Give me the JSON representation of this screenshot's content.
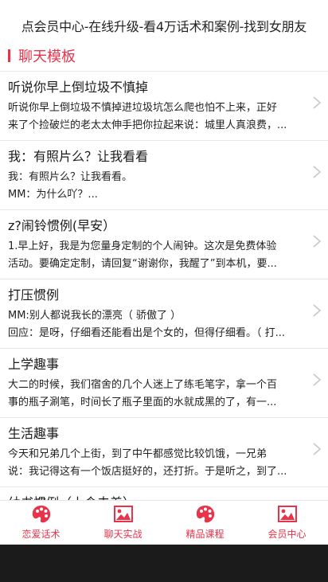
{
  "banner": {
    "text": "点会员中心-在线升级-看4万话术和案例-找到女朋友"
  },
  "section": {
    "title": "聊天模板"
  },
  "items": [
    {
      "title": "听说你早上倒垃圾不慎掉",
      "line1": "听说你早上倒垃圾不慎掉进垃圾坑怎么爬也怕不上来，正好",
      "line2": "来了个捡破烂的老太太伸手把你拉起来说：城里人真浪费，..."
    },
    {
      "title": "我：有照片么？让我看看",
      "line1": "我：有照片么？让我看看。",
      "line2": "MM：为什么吖？..."
    },
    {
      "title": "z?闹铃惯例(早安）",
      "line1": "1.早上好，我是为您量身定制的个人闹钟。这次是免费体验",
      "line2": "活动。要确定定制，请回复“谢谢你，我醒了”到本机，要..."
    },
    {
      "title": "打压惯例",
      "line1": "MM:别人都说我长的漂亮（  骄傲了  ）",
      "line2": "回应：是呀，仔细看还能看出是个女的，但得仔细看。（  打..."
    },
    {
      "title": "上学趣事",
      "line1": "大二的时候，我们宿舍的几个人迷上了练毛笔字，拿一个百",
      "line2": "事的瓶子涮笔，时间长了瓶子里面的水就成黑的了，有一..."
    },
    {
      "title": "生活趣事",
      "line1": "今天和兄弟几个上街，到了中午都感觉比较饥饿，一兄弟",
      "line2": "说：我记得这有一个饭店挺好的，还打折。于是听之，到了..."
    },
    {
      "title": "幼书惯例（上含夫差）",
      "line1": "",
      "line2": ""
    }
  ],
  "tabs": [
    {
      "label": "恋爱话术",
      "icon": "palette-icon"
    },
    {
      "label": "聊天实战",
      "icon": "image-icon"
    },
    {
      "label": "精品课程",
      "icon": "palette-icon"
    },
    {
      "label": "会员中心",
      "icon": "image-icon"
    }
  ],
  "colors": {
    "accent": "#e8334a",
    "divider": "#e6e6e6",
    "chevron": "#c8c8c8",
    "background": "#1b1b1b"
  }
}
